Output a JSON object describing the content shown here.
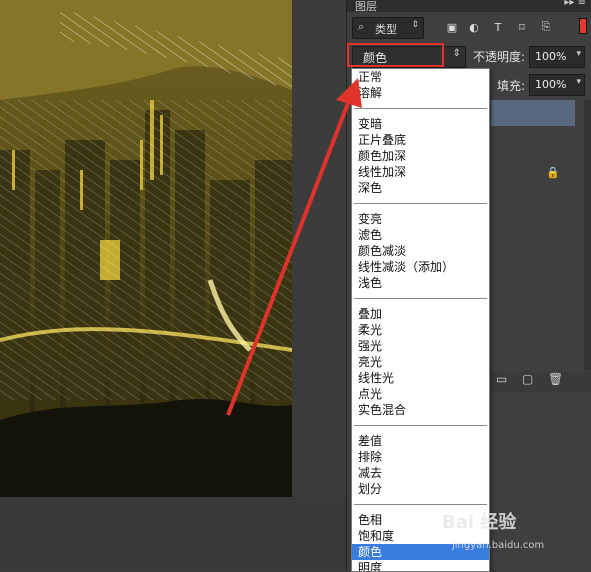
{
  "panel": {
    "title": "图层",
    "menu_icon": "▸▸ ≡",
    "kind_filter": {
      "icon": "search-icon",
      "label": "类型"
    },
    "filter_icons": [
      "image-filter-icon",
      "adjustment-filter-icon",
      "text-filter-icon",
      "shape-filter-icon",
      "smart-object-filter-icon"
    ],
    "blend_mode": "颜色",
    "opacity": {
      "label": "不透明度:",
      "value": "100%"
    },
    "fill": {
      "label": "填充:",
      "value": "100%"
    }
  },
  "dropdown": {
    "groups": [
      [
        "正常",
        "溶解"
      ],
      [
        "变暗",
        "正片叠底",
        "颜色加深",
        "线性加深",
        "深色"
      ],
      [
        "变亮",
        "滤色",
        "颜色减淡",
        "线性减淡（添加）",
        "浅色"
      ],
      [
        "叠加",
        "柔光",
        "强光",
        "亮光",
        "线性光",
        "点光",
        "实色混合"
      ],
      [
        "差值",
        "排除",
        "减去",
        "划分"
      ],
      [
        "色相",
        "饱和度",
        "颜色",
        "明度"
      ]
    ],
    "selected": "颜色"
  },
  "colors": {
    "highlight": "#e0332c",
    "arrow": "#e0332c",
    "selected_item": "#3a7de0",
    "canvas_tint": "#6e6320"
  },
  "watermark": {
    "brand": "Bai 经验",
    "url": "jingyan.baidu.com"
  }
}
